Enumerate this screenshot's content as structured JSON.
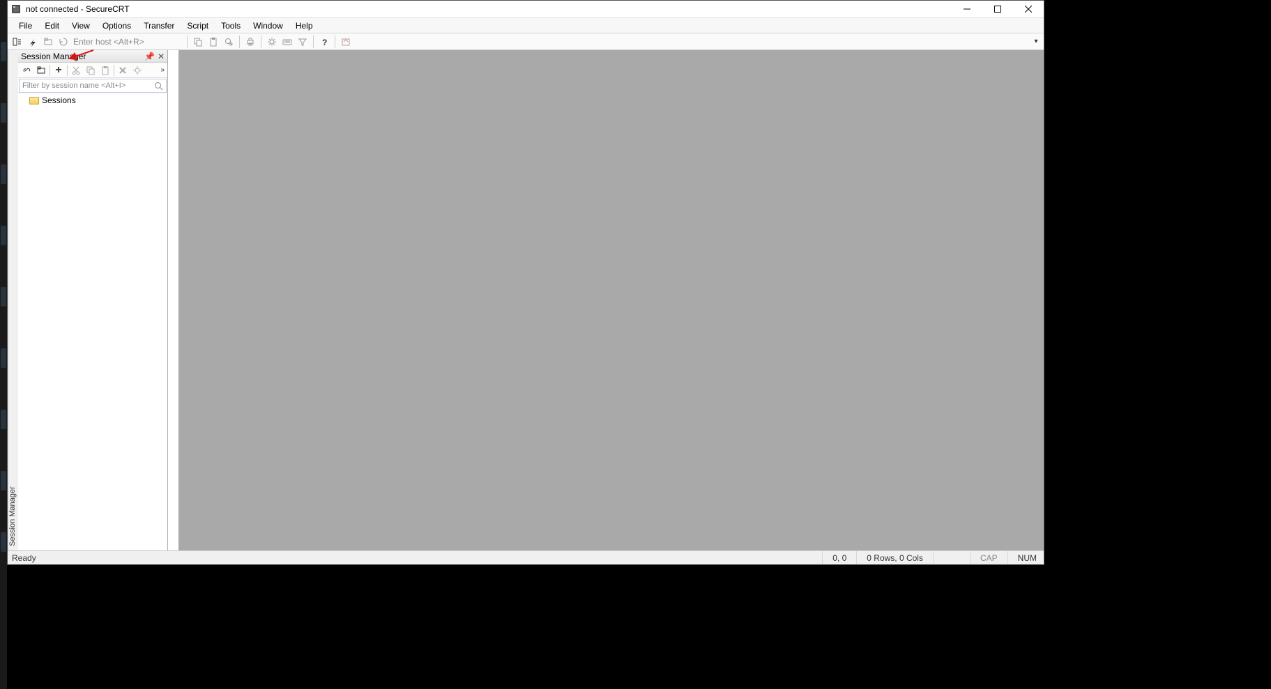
{
  "window": {
    "title": "not connected - SecureCRT"
  },
  "menu": {
    "items": [
      "File",
      "Edit",
      "View",
      "Options",
      "Transfer",
      "Script",
      "Tools",
      "Window",
      "Help"
    ]
  },
  "toolbar": {
    "host_placeholder": "Enter host <Alt+R>"
  },
  "session_panel": {
    "title": "Session Manager",
    "vertical_tab": "Session Manager",
    "filter_placeholder": "Filter by session name <Alt+I>",
    "root_folder": "Sessions"
  },
  "statusbar": {
    "ready": "Ready",
    "coords": "0, 0",
    "rows_cols": "0 Rows, 0 Cols",
    "cap": "CAP",
    "num": "NUM"
  }
}
